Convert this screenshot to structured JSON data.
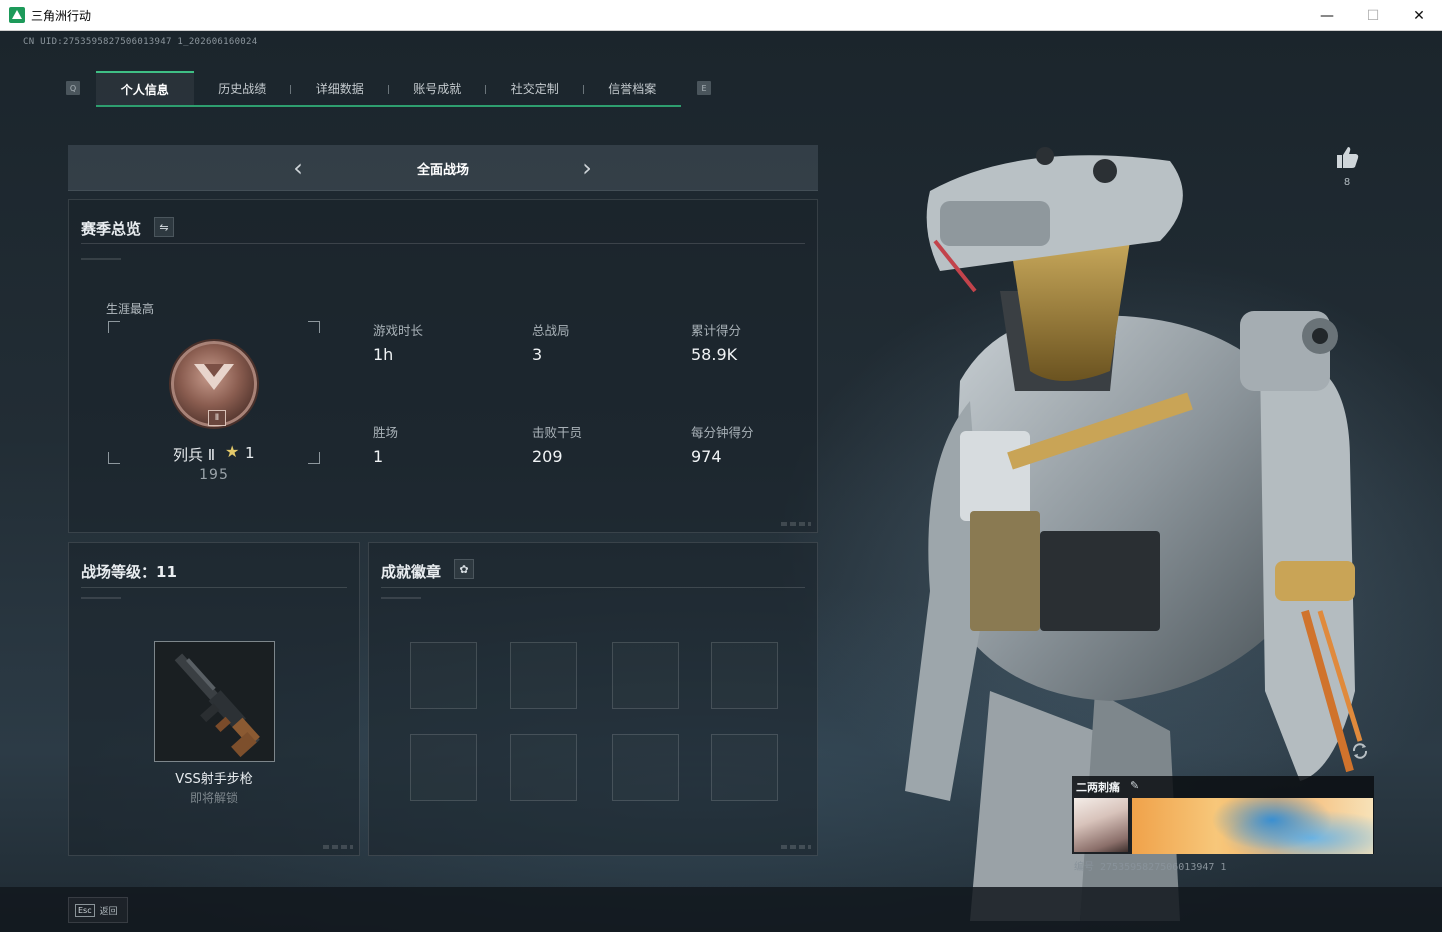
{
  "window": {
    "title": "三角洲行动",
    "minimize": "—",
    "maximize": "☐",
    "close": "✕"
  },
  "uid_header": "CN UID:2753595827506013947 1_202606160024",
  "tabs": {
    "key_left": "Q",
    "key_right": "E",
    "items": [
      {
        "label": "个人信息",
        "active": true
      },
      {
        "label": "历史战绩",
        "active": false
      },
      {
        "label": "详细数据",
        "active": false
      },
      {
        "label": "账号成就",
        "active": false
      },
      {
        "label": "社交定制",
        "active": false
      },
      {
        "label": "信誉档案",
        "active": false
      }
    ]
  },
  "mode": {
    "title": "全面战场",
    "prev": "‹",
    "next": "›"
  },
  "season": {
    "title": "赛季总览",
    "swap_icon": "⇋",
    "career_label": "生涯最高",
    "rank": {
      "name": "列兵 Ⅱ",
      "tier": "Ⅱ",
      "star_icon": "★",
      "stars": "1",
      "points": "195"
    },
    "stats": [
      {
        "label": "游戏时长",
        "value": "1h"
      },
      {
        "label": "总战局",
        "value": "3"
      },
      {
        "label": "累计得分",
        "value": "58.9K"
      },
      {
        "label": "胜场",
        "value": "1"
      },
      {
        "label": "击败干员",
        "value": "209"
      },
      {
        "label": "每分钟得分",
        "value": "974"
      }
    ]
  },
  "level": {
    "title": "战场等级：11",
    "weapon_name": "VSS射手步枪",
    "weapon_status": "即将解锁"
  },
  "badges": {
    "title": "成就徽章",
    "gear_icon": "✿"
  },
  "like": {
    "count": "8"
  },
  "card": {
    "name": "二两刺痛",
    "edit_icon": "✎",
    "id": "编号 2753595827506013947 1"
  },
  "footer": {
    "esc_key": "Esc",
    "esc_label": "返回"
  },
  "colors": {
    "accent": "#3fbf85",
    "tab_underline": "#2e9e6f",
    "rank_bronze": "#8a5d50"
  }
}
